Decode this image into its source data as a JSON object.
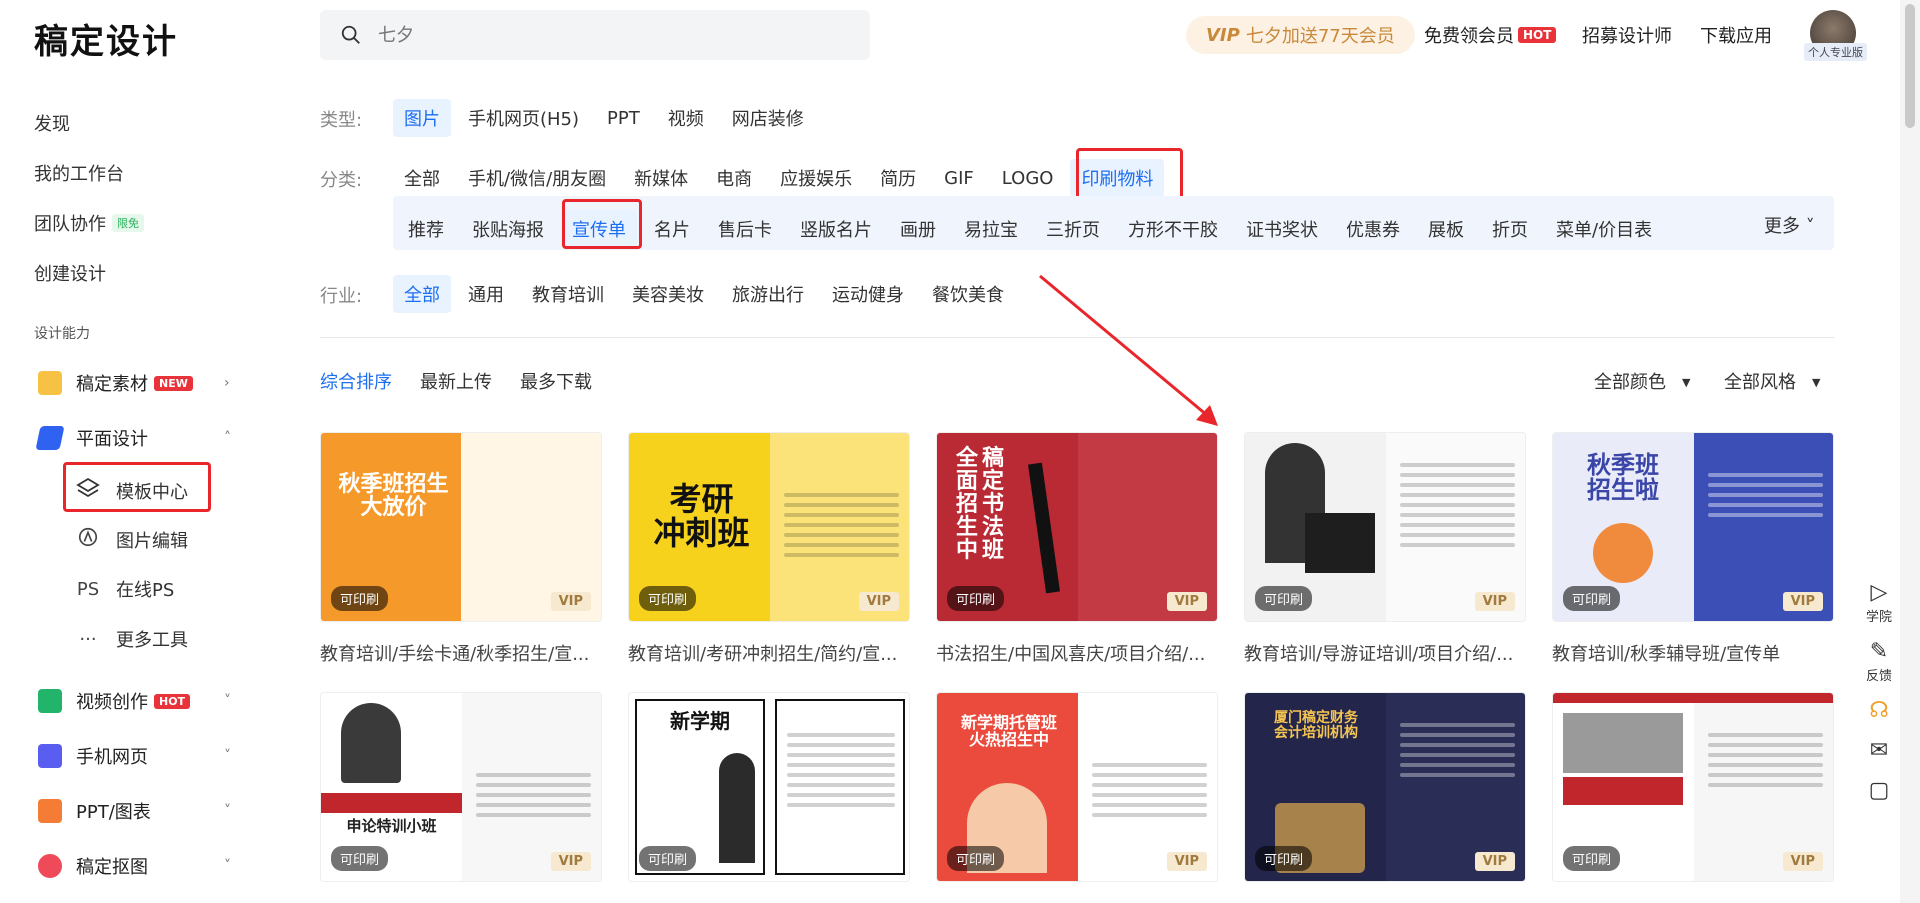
{
  "app": {
    "logo": "稿定设计"
  },
  "search": {
    "placeholder": "七夕"
  },
  "header": {
    "promo_vip": "VIP",
    "promo_text": "七夕加送77天会员",
    "free_member": "免费领会员",
    "hot": "HOT",
    "recruit": "招募设计师",
    "download": "下载应用",
    "avatar_tag": "个人专业版"
  },
  "sidebar": {
    "discover": "发现",
    "workspace": "我的工作台",
    "team": "团队协作",
    "team_badge": "限免",
    "create": "创建设计",
    "ability_heading": "设计能力",
    "groups": [
      {
        "label": "稿定素材",
        "badge": "NEW"
      },
      {
        "label": "平面设计"
      },
      {
        "label": "视频创作",
        "badge": "HOT"
      },
      {
        "label": "手机网页"
      },
      {
        "label": "PPT/图表"
      },
      {
        "label": "稿定抠图"
      }
    ],
    "sub_items": [
      {
        "label": "模板中心"
      },
      {
        "label": "图片编辑"
      },
      {
        "label": "在线PS",
        "icon_text": "PS"
      },
      {
        "label": "更多工具",
        "icon_text": "···"
      }
    ]
  },
  "filters": {
    "type_label": "类型:",
    "types": [
      "图片",
      "手机网页(H5)",
      "PPT",
      "视频",
      "网店装修"
    ],
    "category_label": "分类:",
    "categories": [
      "全部",
      "手机/微信/朋友圈",
      "新媒体",
      "电商",
      "应援娱乐",
      "简历",
      "GIF",
      "LOGO",
      "印刷物料"
    ],
    "subcategories": [
      "推荐",
      "张贴海报",
      "宣传单",
      "名片",
      "售后卡",
      "竖版名片",
      "画册",
      "易拉宝",
      "三折页",
      "方形不干胶",
      "证书奖状",
      "优惠券",
      "展板",
      "折页",
      "菜单/价目表"
    ],
    "more": "更多",
    "industry_label": "行业:",
    "industries": [
      "全部",
      "通用",
      "教育培训",
      "美容美妆",
      "旅游出行",
      "运动健身",
      "餐饮美食"
    ]
  },
  "sort": {
    "options": [
      "综合排序",
      "最新上传",
      "最多下载"
    ],
    "color_filter": "全部颜色",
    "style_filter": "全部风格"
  },
  "cards": [
    {
      "title": "教育培训/手绘卡通/秋季招生/宣...",
      "headline": "秋季班招生\n大放价",
      "print": "可印刷",
      "vip": "VIP",
      "bg1": "#f59a2a",
      "bg2": "#fff6e6",
      "fg": "#ffffff"
    },
    {
      "title": "教育培训/考研冲刺招生/简约/宣...",
      "headline": "考研\n冲刺班",
      "print": "可印刷",
      "vip": "VIP",
      "bg1": "#f6d21d",
      "bg2": "#fbe37a",
      "fg": "#111111"
    },
    {
      "title": "书法招生/中国风喜庆/项目介绍/...",
      "headline": "全稿\n面定\n招书\n生法\n中班",
      "print": "可印刷",
      "vip": "VIP",
      "bg1": "#b92a34",
      "bg2": "#c33a44",
      "fg": "#ffffff"
    },
    {
      "title": "教育培训/导游证培训/项目介绍/...",
      "headline": "",
      "print": "可印刷",
      "vip": "VIP",
      "bg1": "#f2f2f2",
      "bg2": "#fafafa",
      "fg": "#222222"
    },
    {
      "title": "教育培训/秋季辅导班/宣传单",
      "headline": "秋季班\n招生啦",
      "print": "可印刷",
      "vip": "VIP",
      "bg1": "#3a45a8",
      "bg2": "#3c4fb6",
      "fg": "#ffffff"
    },
    {
      "title": "",
      "headline": "申论特训小班",
      "print": "可印刷",
      "vip": "VIP",
      "bg1": "#ffffff",
      "bg2": "#f7f7f7",
      "fg": "#c2262d"
    },
    {
      "title": "",
      "headline": "新学期",
      "print": "可印刷",
      "vip": "",
      "bg1": "#ffffff",
      "bg2": "#ffffff",
      "fg": "#111111"
    },
    {
      "title": "",
      "headline": "新学期托管班\n火热招生中",
      "print": "可印刷",
      "vip": "VIP",
      "bg1": "#ea4b3c",
      "bg2": "#ffffff",
      "fg": "#ffffff"
    },
    {
      "title": "",
      "headline": "厦门稿定财务\n会计培训机构",
      "print": "可印刷",
      "vip": "VIP",
      "bg1": "#23264a",
      "bg2": "#2a2d55",
      "fg": "#f5c451"
    },
    {
      "title": "",
      "headline": "",
      "print": "可印刷",
      "vip": "VIP",
      "bg1": "#ffffff",
      "bg2": "#f6f6f6",
      "fg": "#c2262d"
    }
  ],
  "float_bar": [
    {
      "label": "学院",
      "icon": "play-icon"
    },
    {
      "label": "反馈",
      "icon": "edit-icon"
    },
    {
      "label": "",
      "icon": "headset-icon"
    },
    {
      "label": "",
      "icon": "mail-icon"
    },
    {
      "label": "",
      "icon": "chat-icon"
    }
  ],
  "colors": {
    "accent": "#1d6ff2",
    "highlight": "#e8262c"
  }
}
